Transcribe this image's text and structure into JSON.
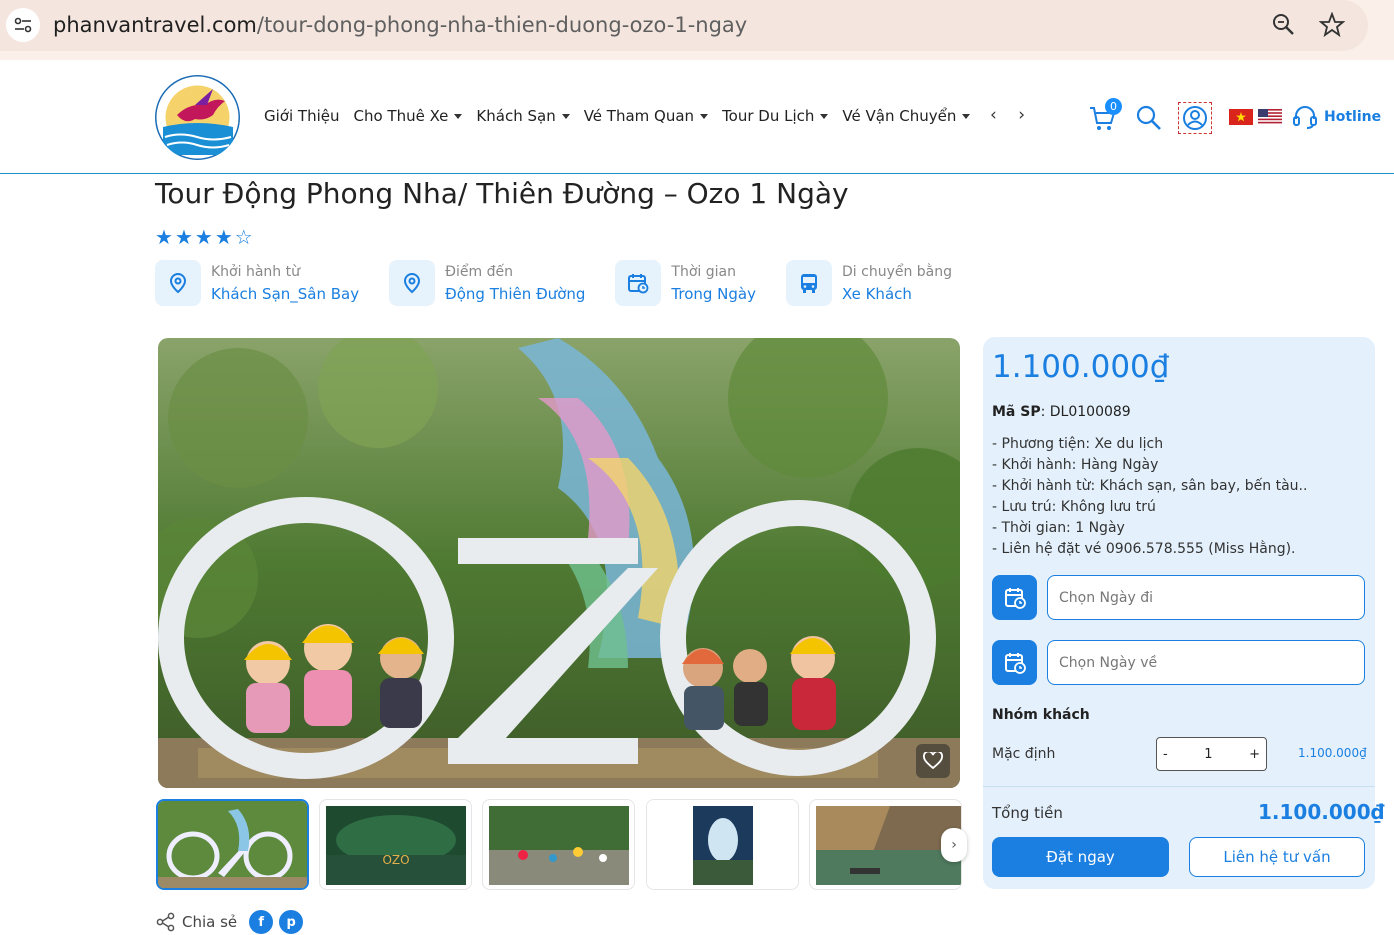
{
  "browser": {
    "url_domain": "phanvantravel.com",
    "url_path": "/tour-dong-phong-nha-thien-duong-ozo-1-ngay"
  },
  "header": {
    "nav": [
      {
        "label": "Giới Thiệu",
        "has_dropdown": false
      },
      {
        "label": "Cho Thuê Xe",
        "has_dropdown": true
      },
      {
        "label": "Khách Sạn",
        "has_dropdown": true
      },
      {
        "label": "Vé Tham Quan",
        "has_dropdown": true
      },
      {
        "label": "Tour Du Lịch",
        "has_dropdown": true
      },
      {
        "label": "Vé Vận Chuyển",
        "has_dropdown": true
      }
    ],
    "nav_arrows": "‹ ›",
    "cart_count": "0",
    "hotline": "Hotline",
    "accent": "#1a7fe0"
  },
  "tour": {
    "title": "Tour Động Phong Nha/ Thiên Đường – Ozo 1 Ngày",
    "rating": 4,
    "rating_max": 5,
    "info": [
      {
        "icon": "location-pin-icon",
        "label": "Khởi hành từ",
        "value": "Khách Sạn_Sân Bay"
      },
      {
        "icon": "location-pin-icon",
        "label": "Điểm đến",
        "value": "Động Thiên Đường"
      },
      {
        "icon": "calendar-clock-icon",
        "label": "Thời gian",
        "value": "Trong Ngày"
      },
      {
        "icon": "bus-icon",
        "label": "Di chuyển bằng",
        "value": "Xe Khách"
      }
    ]
  },
  "gallery": {
    "thumbnails": [
      "ozo-sign",
      "cave-water-ozo",
      "camp-site",
      "cave-opening",
      "river-boat"
    ]
  },
  "share": {
    "label": "Chia sẻ",
    "facebook": "f",
    "pinterest": "p"
  },
  "booking": {
    "price": "1.100.000₫",
    "sku_label": "Mã SP",
    "sku_value": ": DL0100089",
    "features": [
      "- Phương tiện: Xe du lịch",
      "- Khởi hành: Hàng Ngày",
      "- Khởi hành từ: Khách sạn, sân bay, bến tàu..",
      "- Lưu trú: Không lưu trú",
      "- Thời gian: 1 Ngày",
      "- Liên hệ đặt vé 0906.578.555 (Miss Hằng)."
    ],
    "date_from_placeholder": "Chọn Ngày đi",
    "date_to_placeholder": "Chọn Ngày về",
    "group_title": "Nhóm khách",
    "guest_label": "Mặc định",
    "minus": "-",
    "quantity": "1",
    "plus": "+",
    "guest_price": "1.100.000₫",
    "total_label": "Tổng tiền",
    "total_value": "1.100.000₫",
    "book_button": "Đặt ngay",
    "contact_button": "Liên hệ tư vấn"
  }
}
